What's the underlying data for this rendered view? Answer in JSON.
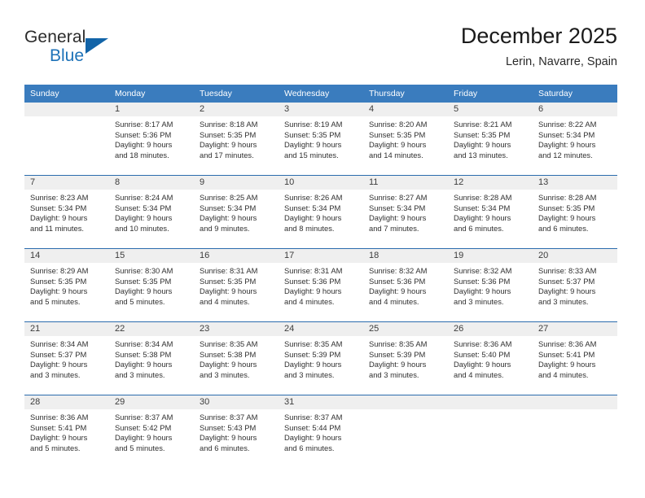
{
  "brand": {
    "name_line1": "General",
    "name_line2": "Blue",
    "logo_icon": "triangle-logo-icon"
  },
  "header": {
    "title": "December 2025",
    "location": "Lerin, Navarre, Spain"
  },
  "colors": {
    "header_blue": "#3a7cbe",
    "separator_blue": "#2b6cad",
    "daynum_bar": "#efefef",
    "brand_blue": "#1d72b8",
    "text": "#303030"
  },
  "weekdays": [
    "Sunday",
    "Monday",
    "Tuesday",
    "Wednesday",
    "Thursday",
    "Friday",
    "Saturday"
  ],
  "weeks": [
    [
      {
        "day": "",
        "sunrise": "",
        "sunset": "",
        "daylight1": "",
        "daylight2": ""
      },
      {
        "day": "1",
        "sunrise": "Sunrise: 8:17 AM",
        "sunset": "Sunset: 5:36 PM",
        "daylight1": "Daylight: 9 hours",
        "daylight2": "and 18 minutes."
      },
      {
        "day": "2",
        "sunrise": "Sunrise: 8:18 AM",
        "sunset": "Sunset: 5:35 PM",
        "daylight1": "Daylight: 9 hours",
        "daylight2": "and 17 minutes."
      },
      {
        "day": "3",
        "sunrise": "Sunrise: 8:19 AM",
        "sunset": "Sunset: 5:35 PM",
        "daylight1": "Daylight: 9 hours",
        "daylight2": "and 15 minutes."
      },
      {
        "day": "4",
        "sunrise": "Sunrise: 8:20 AM",
        "sunset": "Sunset: 5:35 PM",
        "daylight1": "Daylight: 9 hours",
        "daylight2": "and 14 minutes."
      },
      {
        "day": "5",
        "sunrise": "Sunrise: 8:21 AM",
        "sunset": "Sunset: 5:35 PM",
        "daylight1": "Daylight: 9 hours",
        "daylight2": "and 13 minutes."
      },
      {
        "day": "6",
        "sunrise": "Sunrise: 8:22 AM",
        "sunset": "Sunset: 5:34 PM",
        "daylight1": "Daylight: 9 hours",
        "daylight2": "and 12 minutes."
      }
    ],
    [
      {
        "day": "7",
        "sunrise": "Sunrise: 8:23 AM",
        "sunset": "Sunset: 5:34 PM",
        "daylight1": "Daylight: 9 hours",
        "daylight2": "and 11 minutes."
      },
      {
        "day": "8",
        "sunrise": "Sunrise: 8:24 AM",
        "sunset": "Sunset: 5:34 PM",
        "daylight1": "Daylight: 9 hours",
        "daylight2": "and 10 minutes."
      },
      {
        "day": "9",
        "sunrise": "Sunrise: 8:25 AM",
        "sunset": "Sunset: 5:34 PM",
        "daylight1": "Daylight: 9 hours",
        "daylight2": "and 9 minutes."
      },
      {
        "day": "10",
        "sunrise": "Sunrise: 8:26 AM",
        "sunset": "Sunset: 5:34 PM",
        "daylight1": "Daylight: 9 hours",
        "daylight2": "and 8 minutes."
      },
      {
        "day": "11",
        "sunrise": "Sunrise: 8:27 AM",
        "sunset": "Sunset: 5:34 PM",
        "daylight1": "Daylight: 9 hours",
        "daylight2": "and 7 minutes."
      },
      {
        "day": "12",
        "sunrise": "Sunrise: 8:28 AM",
        "sunset": "Sunset: 5:34 PM",
        "daylight1": "Daylight: 9 hours",
        "daylight2": "and 6 minutes."
      },
      {
        "day": "13",
        "sunrise": "Sunrise: 8:28 AM",
        "sunset": "Sunset: 5:35 PM",
        "daylight1": "Daylight: 9 hours",
        "daylight2": "and 6 minutes."
      }
    ],
    [
      {
        "day": "14",
        "sunrise": "Sunrise: 8:29 AM",
        "sunset": "Sunset: 5:35 PM",
        "daylight1": "Daylight: 9 hours",
        "daylight2": "and 5 minutes."
      },
      {
        "day": "15",
        "sunrise": "Sunrise: 8:30 AM",
        "sunset": "Sunset: 5:35 PM",
        "daylight1": "Daylight: 9 hours",
        "daylight2": "and 5 minutes."
      },
      {
        "day": "16",
        "sunrise": "Sunrise: 8:31 AM",
        "sunset": "Sunset: 5:35 PM",
        "daylight1": "Daylight: 9 hours",
        "daylight2": "and 4 minutes."
      },
      {
        "day": "17",
        "sunrise": "Sunrise: 8:31 AM",
        "sunset": "Sunset: 5:36 PM",
        "daylight1": "Daylight: 9 hours",
        "daylight2": "and 4 minutes."
      },
      {
        "day": "18",
        "sunrise": "Sunrise: 8:32 AM",
        "sunset": "Sunset: 5:36 PM",
        "daylight1": "Daylight: 9 hours",
        "daylight2": "and 4 minutes."
      },
      {
        "day": "19",
        "sunrise": "Sunrise: 8:32 AM",
        "sunset": "Sunset: 5:36 PM",
        "daylight1": "Daylight: 9 hours",
        "daylight2": "and 3 minutes."
      },
      {
        "day": "20",
        "sunrise": "Sunrise: 8:33 AM",
        "sunset": "Sunset: 5:37 PM",
        "daylight1": "Daylight: 9 hours",
        "daylight2": "and 3 minutes."
      }
    ],
    [
      {
        "day": "21",
        "sunrise": "Sunrise: 8:34 AM",
        "sunset": "Sunset: 5:37 PM",
        "daylight1": "Daylight: 9 hours",
        "daylight2": "and 3 minutes."
      },
      {
        "day": "22",
        "sunrise": "Sunrise: 8:34 AM",
        "sunset": "Sunset: 5:38 PM",
        "daylight1": "Daylight: 9 hours",
        "daylight2": "and 3 minutes."
      },
      {
        "day": "23",
        "sunrise": "Sunrise: 8:35 AM",
        "sunset": "Sunset: 5:38 PM",
        "daylight1": "Daylight: 9 hours",
        "daylight2": "and 3 minutes."
      },
      {
        "day": "24",
        "sunrise": "Sunrise: 8:35 AM",
        "sunset": "Sunset: 5:39 PM",
        "daylight1": "Daylight: 9 hours",
        "daylight2": "and 3 minutes."
      },
      {
        "day": "25",
        "sunrise": "Sunrise: 8:35 AM",
        "sunset": "Sunset: 5:39 PM",
        "daylight1": "Daylight: 9 hours",
        "daylight2": "and 3 minutes."
      },
      {
        "day": "26",
        "sunrise": "Sunrise: 8:36 AM",
        "sunset": "Sunset: 5:40 PM",
        "daylight1": "Daylight: 9 hours",
        "daylight2": "and 4 minutes."
      },
      {
        "day": "27",
        "sunrise": "Sunrise: 8:36 AM",
        "sunset": "Sunset: 5:41 PM",
        "daylight1": "Daylight: 9 hours",
        "daylight2": "and 4 minutes."
      }
    ],
    [
      {
        "day": "28",
        "sunrise": "Sunrise: 8:36 AM",
        "sunset": "Sunset: 5:41 PM",
        "daylight1": "Daylight: 9 hours",
        "daylight2": "and 5 minutes."
      },
      {
        "day": "29",
        "sunrise": "Sunrise: 8:37 AM",
        "sunset": "Sunset: 5:42 PM",
        "daylight1": "Daylight: 9 hours",
        "daylight2": "and 5 minutes."
      },
      {
        "day": "30",
        "sunrise": "Sunrise: 8:37 AM",
        "sunset": "Sunset: 5:43 PM",
        "daylight1": "Daylight: 9 hours",
        "daylight2": "and 6 minutes."
      },
      {
        "day": "31",
        "sunrise": "Sunrise: 8:37 AM",
        "sunset": "Sunset: 5:44 PM",
        "daylight1": "Daylight: 9 hours",
        "daylight2": "and 6 minutes."
      },
      {
        "day": "",
        "sunrise": "",
        "sunset": "",
        "daylight1": "",
        "daylight2": ""
      },
      {
        "day": "",
        "sunrise": "",
        "sunset": "",
        "daylight1": "",
        "daylight2": ""
      },
      {
        "day": "",
        "sunrise": "",
        "sunset": "",
        "daylight1": "",
        "daylight2": ""
      }
    ]
  ]
}
